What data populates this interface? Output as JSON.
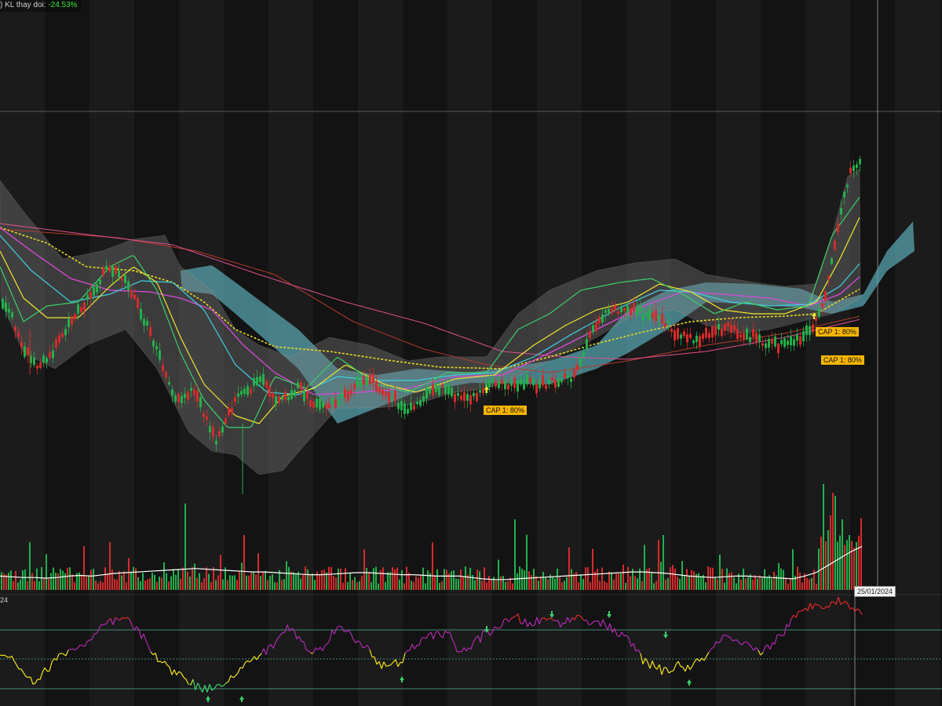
{
  "header": {
    "prefix": ") KL thay doi: ",
    "value": "-24.53%",
    "value_color": "#39e639"
  },
  "oscillator": {
    "label": "24"
  },
  "annotations": [
    {
      "text": "CAP 1: 80%"
    },
    {
      "text": "CAP 1: 80%"
    },
    {
      "text": "CAP 1: 80%"
    }
  ],
  "cursor_date": "25/01/2024",
  "colors": {
    "background": "#131313",
    "band_alt": "#1b1b1b",
    "up": "#22b14c",
    "down": "#d62b2b",
    "kumo": "#5fb7c4",
    "bollinger": "#7d7d7d",
    "ma_fast": "#3cd06a",
    "ma_mid": "#f0e62f",
    "ma_cyan": "#3fd1e6",
    "ma_magenta": "#d94bd9",
    "ma_dotted": "#e6d625",
    "ma_slow_red": "#b53a2a",
    "ma_pink": "#e0508f",
    "volume_avg": "#ffffff",
    "osc_magenta": "#b02ab0",
    "osc_yellow": "#f2e21d",
    "osc_red": "#e02a2a",
    "osc_level": "#4fb39a",
    "cap_bg": "#f5b400"
  },
  "chart_data": {
    "type": "candlestick",
    "price_panel": {
      "series": [
        {
          "type": "candle",
          "values": [
            340,
            300,
            250,
            220,
            235,
            270,
            300,
            330,
            360,
            395,
            380,
            345,
            300,
            250,
            190,
            155,
            180,
            140,
            90,
            135,
            175,
            185,
            200,
            160,
            165,
            185,
            155,
            150,
            160,
            175,
            195,
            205,
            170,
            165,
            140,
            160,
            175,
            185,
            170,
            160,
            175,
            198,
            193,
            186,
            192,
            188,
            194,
            198,
            205,
            260,
            300,
            320,
            318,
            322,
            306,
            312,
            286,
            272,
            266,
            274,
            282,
            290,
            276,
            272,
            260,
            258,
            262,
            268,
            290,
            340,
            460,
            555,
            575
          ]
        }
      ]
    },
    "volume_panel": {
      "series": [
        {
          "name": "volume_avg",
          "values": [
            20,
            19,
            18,
            18,
            17,
            18,
            20,
            21,
            20,
            22,
            24,
            25,
            26,
            27,
            28,
            29,
            30,
            31,
            30,
            29,
            28,
            27,
            26,
            26,
            25,
            24,
            23,
            22,
            22,
            23,
            24,
            25,
            25,
            24,
            23,
            22,
            22,
            21,
            20,
            20,
            20,
            18,
            16,
            15,
            15,
            16,
            17,
            18,
            19,
            20,
            21,
            22,
            23,
            24,
            25,
            26,
            26,
            25,
            24,
            22,
            20,
            19,
            18,
            19,
            20,
            20,
            19,
            18,
            17,
            16,
            20,
            25,
            35,
            45,
            55,
            63
          ]
        }
      ]
    },
    "oscillator_panel": {
      "series": [
        {
          "name": "oscillator",
          "values": [
            57,
            49,
            35,
            23,
            36,
            49,
            58,
            61,
            68,
            84,
            88,
            90,
            78,
            62,
            45,
            35,
            30,
            20,
            16,
            22,
            27,
            37,
            49,
            55,
            66,
            82,
            72,
            54,
            60,
            79,
            80,
            67,
            62,
            42,
            40,
            47,
            62,
            69,
            76,
            75,
            55,
            62,
            73,
            81,
            87,
            92,
            85,
            89,
            90,
            86,
            93,
            90,
            88,
            82,
            74,
            64,
            46,
            40,
            34,
            43,
            37,
            48,
            58,
            73,
            64,
            62,
            55,
            62,
            75,
            90,
            100,
            108,
            106,
            110,
            106,
            94
          ]
        }
      ]
    }
  }
}
